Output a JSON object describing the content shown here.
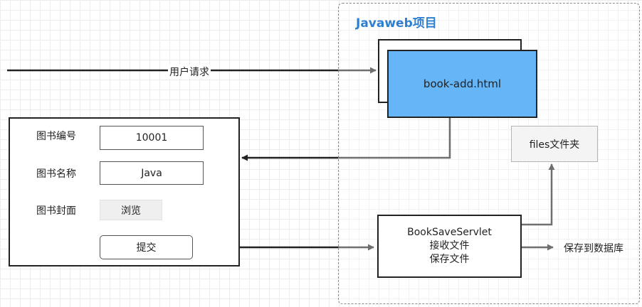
{
  "project": {
    "title": "Javaweb项目"
  },
  "html_page": {
    "label": "book-add.html"
  },
  "files_folder": {
    "label": "files文件夹"
  },
  "servlet": {
    "name": "BookSaveServlet",
    "line2": "接收文件",
    "line3": "保存文件"
  },
  "form": {
    "fields": [
      {
        "label": "图书编号",
        "value": "10001"
      },
      {
        "label": "图书名称",
        "value": "Java"
      },
      {
        "label": "图书封面",
        "button": "浏览"
      }
    ],
    "submit_label": "提交"
  },
  "edges": {
    "user_request": "用户请求",
    "save_to_db": "保存到数据库"
  },
  "colors": {
    "page_fill": "#66b5f6",
    "title_blue": "#2f7fd0",
    "line": "#222222"
  }
}
